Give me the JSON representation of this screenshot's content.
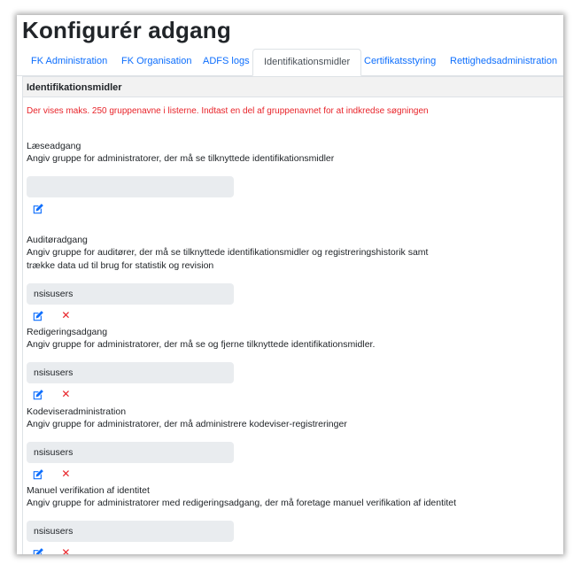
{
  "page": {
    "title": "Konfigurér adgang"
  },
  "tabs": [
    {
      "label": "FK Administration",
      "active": false
    },
    {
      "label": "FK Organisation",
      "active": false
    },
    {
      "label": "ADFS logs",
      "active": false
    },
    {
      "label": "Identifikationsmidler",
      "active": true
    },
    {
      "label": "Certifikatsstyring",
      "active": false
    },
    {
      "label": "Rettighedsadministration",
      "active": false
    }
  ],
  "card": {
    "header": "Identifikationsmidler",
    "notice": "Der vises maks. 250 gruppenavne i listerne. Indtast en del af gruppenavnet for at indkredse søgningen"
  },
  "sections": [
    {
      "title": "Læseadgang",
      "desc_line1": "Angiv gruppe for administratorer, der må se tilknyttede identifikationsmidler",
      "desc_line2": "",
      "group": "",
      "has_delete": false
    },
    {
      "title": "Auditøradgang",
      "desc_line1": "Angiv gruppe for auditører, der må se tilknyttede identifikationsmidler og registreringshistorik samt",
      "desc_line2": "trække data ud til brug for statistik og revision",
      "group": "nsisusers",
      "has_delete": true
    },
    {
      "title": "Redigeringsadgang",
      "desc_line1": "Angiv gruppe for administratorer, der må se og fjerne tilknyttede identifikationsmidler.",
      "desc_line2": "",
      "group": "nsisusers",
      "has_delete": true
    },
    {
      "title": "Kodeviseradministration",
      "desc_line1": "Angiv gruppe for administratorer, der må administrere kodeviser-registreringer",
      "desc_line2": "",
      "group": "nsisusers",
      "has_delete": true
    },
    {
      "title": "Manuel verifikation af identitet",
      "desc_line1": "Angiv gruppe for administratorer med redigeringsadgang, der må foretage manuel verifikation af identitet",
      "desc_line2": "",
      "group": "nsisusers",
      "has_delete": true
    }
  ],
  "icons": {
    "edit": "edit-icon",
    "delete": "close-icon"
  },
  "colors": {
    "link": "#0d6efd",
    "danger": "#e8242a",
    "field_bg": "#e9ecef"
  }
}
